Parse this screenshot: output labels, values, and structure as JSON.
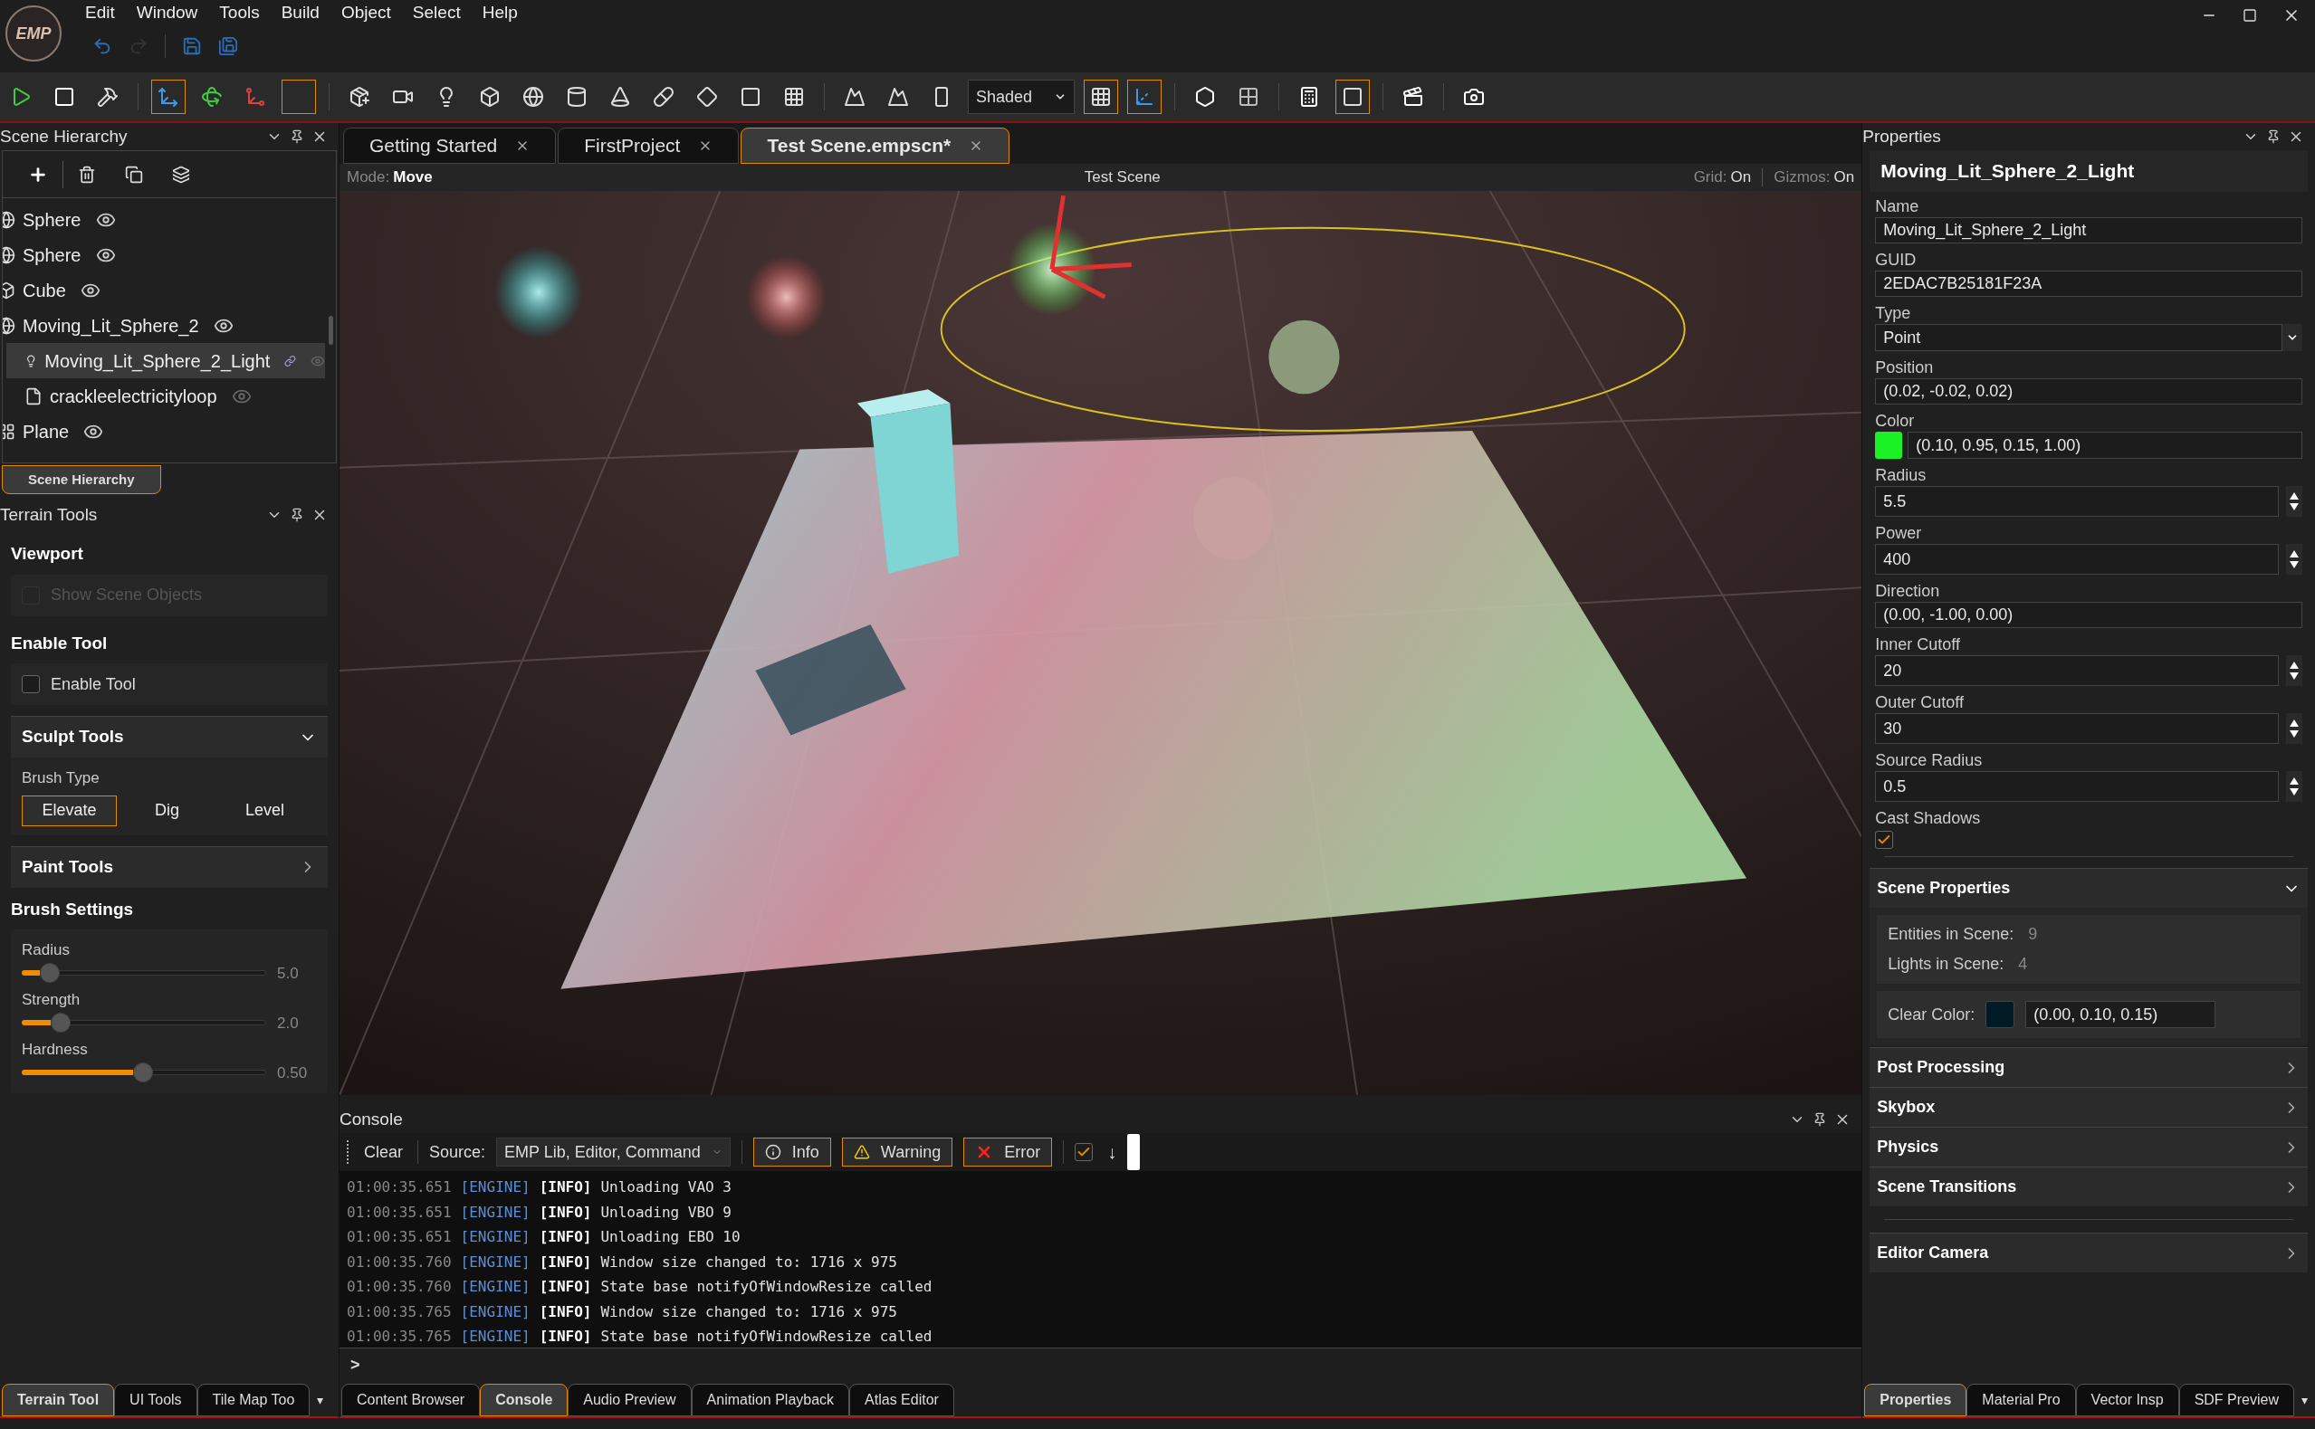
{
  "app": {
    "logo": "EMP",
    "menu": [
      "Edit",
      "Window",
      "Tools",
      "Build",
      "Object",
      "Select",
      "Help"
    ]
  },
  "toolbar": {
    "items": [
      {
        "kind": "button",
        "selected": false
      },
      {
        "kind": "button",
        "selected": false
      },
      {
        "kind": "button",
        "selected": false
      },
      {
        "kind": "separator"
      },
      {
        "kind": "button",
        "selected": true
      },
      {
        "kind": "button",
        "selected": false
      },
      {
        "kind": "button",
        "selected": false
      },
      {
        "kind": "button",
        "selected": true
      },
      {
        "kind": "separator"
      },
      {
        "kind": "button",
        "selected": false
      },
      {
        "kind": "button",
        "selected": false
      },
      {
        "kind": "button",
        "selected": false
      },
      {
        "kind": "button",
        "selected": false
      },
      {
        "kind": "button",
        "selected": false
      },
      {
        "kind": "button",
        "selected": false
      },
      {
        "kind": "button",
        "selected": false
      },
      {
        "kind": "button",
        "selected": false
      },
      {
        "kind": "button",
        "selected": false
      },
      {
        "kind": "button",
        "selected": false
      },
      {
        "kind": "button",
        "selected": false
      },
      {
        "kind": "separator"
      },
      {
        "kind": "button",
        "selected": false
      },
      {
        "kind": "button",
        "selected": false
      },
      {
        "kind": "button",
        "selected": false
      },
      {
        "kind": "dropdown",
        "value": "Shaded"
      },
      {
        "kind": "button",
        "selected": true
      },
      {
        "kind": "button",
        "selected": true
      },
      {
        "kind": "separator"
      },
      {
        "kind": "button",
        "selected": false
      },
      {
        "kind": "button",
        "selected": false
      },
      {
        "kind": "separator"
      },
      {
        "kind": "button",
        "selected": false
      },
      {
        "kind": "button",
        "selected": true
      },
      {
        "kind": "separator"
      },
      {
        "kind": "button",
        "selected": false
      },
      {
        "kind": "separator"
      },
      {
        "kind": "button",
        "selected": false
      }
    ]
  },
  "hierarchy": {
    "title": "Scene Hierarchy",
    "items": [
      {
        "label": "Sphere",
        "kind": "sphere",
        "selected": false,
        "linked": false,
        "dimmed": false
      },
      {
        "label": "Sphere",
        "kind": "sphere",
        "selected": false,
        "linked": false,
        "dimmed": false
      },
      {
        "label": "Cube",
        "kind": "cube",
        "selected": false,
        "linked": false,
        "dimmed": false
      },
      {
        "label": "Moving_Lit_Sphere_2",
        "kind": "sphere",
        "selected": false,
        "linked": false,
        "dimmed": false,
        "children": [
          {
            "label": "Moving_Lit_Sphere_2_Light",
            "kind": "light",
            "selected": true,
            "linked": true,
            "dimmed": true
          },
          {
            "label": "crackleelectricityloop",
            "kind": "file",
            "selected": false,
            "linked": false,
            "dimmed": true
          }
        ]
      },
      {
        "label": "Plane",
        "kind": "plane",
        "selected": false,
        "linked": false,
        "dimmed": false
      }
    ],
    "tabs": [
      {
        "label": "Scene Hierarchy",
        "selected": true
      }
    ]
  },
  "terrain": {
    "title": "Terrain Tools",
    "viewport": {
      "heading": "Viewport",
      "checkbox": {
        "label": "Show Scene Objects",
        "checked": false,
        "disabled": true
      }
    },
    "enable": {
      "heading": "Enable Tool",
      "checkbox": {
        "label": "Enable Tool",
        "checked": false,
        "disabled": false
      }
    },
    "sections": [
      {
        "title": "Sculpt Tools",
        "expanded": true,
        "brush_label": "Brush Type",
        "brushes": [
          {
            "label": "Elevate",
            "selected": true
          },
          {
            "label": "Dig",
            "selected": false
          },
          {
            "label": "Level",
            "selected": false
          }
        ]
      },
      {
        "title": "Paint Tools",
        "expanded": false
      }
    ],
    "brush_settings": {
      "heading": "Brush Settings",
      "sliders": [
        {
          "label": "Radius",
          "level": 0.08,
          "reading": "5.0"
        },
        {
          "label": "Strength",
          "level": 0.13,
          "reading": "2.0"
        },
        {
          "label": "Hardness",
          "level": 0.5,
          "reading": "0.50"
        }
      ]
    },
    "tabs": [
      {
        "label": "Terrain Tool",
        "selected": true
      },
      {
        "label": "UI Tools",
        "selected": false
      },
      {
        "label": "Tile Map Too",
        "selected": false
      }
    ],
    "tabs_more": "▾"
  },
  "editor_tabs": [
    {
      "label": "Getting Started",
      "selected": false
    },
    {
      "label": "FirstProject",
      "selected": false
    },
    {
      "label": "Test Scene.empscn*",
      "selected": true
    }
  ],
  "viewport": {
    "mode_label": "Mode:",
    "mode": "Move",
    "title": "Test Scene",
    "grid_label": "Grid:",
    "grid": "On",
    "gizmos_label": "Gizmos:",
    "gizmos": "On"
  },
  "console": {
    "title": "Console",
    "clear": "Clear",
    "source_label": "Source:",
    "source": "EMP Lib, Editor, Command",
    "filters": [
      {
        "label": "Info",
        "kind": "info",
        "on": true
      },
      {
        "label": "Warning",
        "kind": "warning",
        "on": true
      },
      {
        "label": "Error",
        "kind": "error",
        "on": true
      }
    ],
    "autoscroll": true,
    "scroll_arrow": "↓",
    "lines": [
      {
        "time": "01:00:35.651",
        "source": "[ENGINE]",
        "level": "[INFO]",
        "message": "Unloading VAO 3"
      },
      {
        "time": "01:00:35.651",
        "source": "[ENGINE]",
        "level": "[INFO]",
        "message": "Unloading VBO 9"
      },
      {
        "time": "01:00:35.651",
        "source": "[ENGINE]",
        "level": "[INFO]",
        "message": "Unloading EBO 10"
      },
      {
        "time": "01:00:35.760",
        "source": "[ENGINE]",
        "level": "[INFO]",
        "message": "Window size changed to: 1716 x 975"
      },
      {
        "time": "01:00:35.760",
        "source": "[ENGINE]",
        "level": "[INFO]",
        "message": "State base notifyOfWindowResize called"
      },
      {
        "time": "01:00:35.765",
        "source": "[ENGINE]",
        "level": "[INFO]",
        "message": "Window size changed to: 1716 x 975"
      },
      {
        "time": "01:00:35.765",
        "source": "[ENGINE]",
        "level": "[INFO]",
        "message": "State base notifyOfWindowResize called"
      }
    ],
    "prompt": ">",
    "tabs": [
      {
        "label": "Content Browser",
        "selected": false
      },
      {
        "label": "Console",
        "selected": true
      },
      {
        "label": "Audio Preview",
        "selected": false
      },
      {
        "label": "Animation Playback",
        "selected": false
      },
      {
        "label": "Atlas Editor",
        "selected": false
      }
    ]
  },
  "properties": {
    "title": "Properties",
    "object": "Moving_Lit_Sphere_2_Light",
    "fields": [
      {
        "label": "Name",
        "kind": "text",
        "value": "Moving_Lit_Sphere_2_Light"
      },
      {
        "label": "GUID",
        "kind": "text",
        "value": "2EDAC7B25181F23A"
      },
      {
        "label": "Type",
        "kind": "select",
        "value": "Point"
      },
      {
        "label": "Position",
        "kind": "text",
        "value": "(0.02, -0.02, 0.02)"
      },
      {
        "label": "Color",
        "kind": "color",
        "value": "(0.10, 0.95, 0.15, 1.00)",
        "color": "#1af226"
      },
      {
        "label": "Radius",
        "kind": "number",
        "value": "5.5"
      },
      {
        "label": "Power",
        "kind": "number",
        "value": "400"
      },
      {
        "label": "Direction",
        "kind": "text",
        "value": "(0.00, -1.00, 0.00)"
      },
      {
        "label": "Inner Cutoff",
        "kind": "number",
        "value": "20"
      },
      {
        "label": "Outer Cutoff",
        "kind": "number",
        "value": "30"
      },
      {
        "label": "Source Radius",
        "kind": "number",
        "value": "0.5"
      },
      {
        "label": "Cast Shadows",
        "kind": "checkbox",
        "checked": true
      }
    ],
    "scene": {
      "title": "Scene Properties",
      "expanded": true,
      "stats": [
        {
          "label": "Entities in Scene:",
          "value": "9"
        },
        {
          "label": "Lights in Scene:",
          "value": "4"
        }
      ],
      "clear_color": {
        "label": "Clear Color:",
        "value": "(0.00, 0.10, 0.15)",
        "color": "#001a26"
      }
    },
    "sections": [
      {
        "title": "Post Processing",
        "expanded": false
      },
      {
        "title": "Skybox",
        "expanded": false
      },
      {
        "title": "Physics",
        "expanded": false
      },
      {
        "title": "Scene Transitions",
        "expanded": false
      }
    ],
    "camera": {
      "title": "Editor Camera",
      "expanded": false
    },
    "tabs": [
      {
        "label": "Properties",
        "selected": true
      },
      {
        "label": "Material Pro",
        "selected": false
      },
      {
        "label": "Vector Insp",
        "selected": false
      },
      {
        "label": "SDF Preview",
        "selected": false
      }
    ],
    "tabs_more": "▾"
  }
}
